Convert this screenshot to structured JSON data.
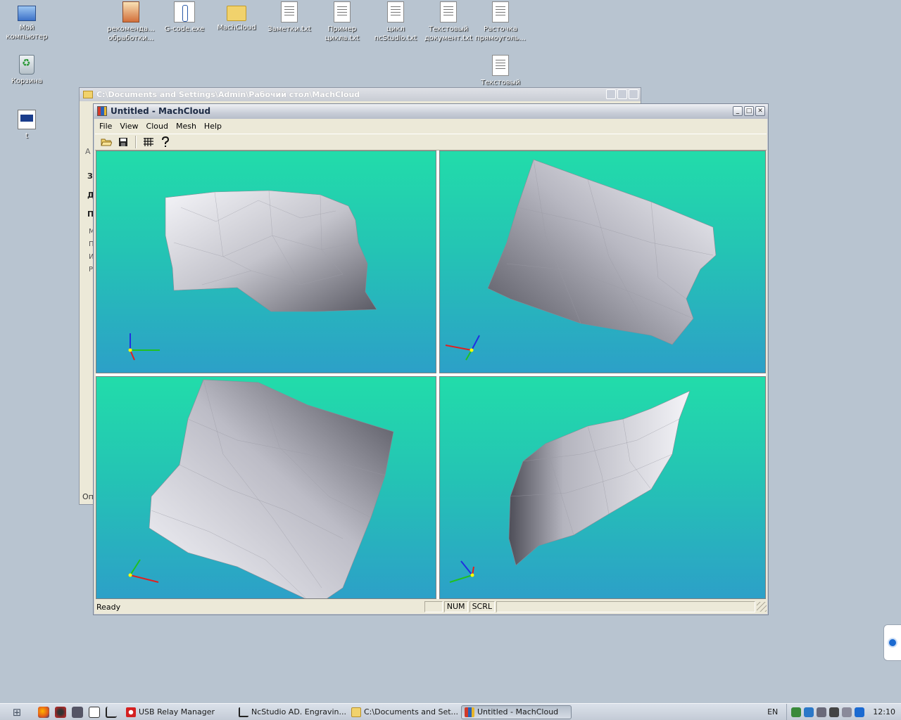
{
  "desktop": {
    "icons": [
      {
        "label": "Мой компьютер",
        "icon": "my-computer-icon"
      },
      {
        "label": "Корзина",
        "icon": "recycle-bin-icon"
      },
      {
        "label": "t",
        "icon": "application-shortcut-icon"
      },
      {
        "label": "рекоменда... обработки...",
        "icon": "winrar-archive-icon"
      },
      {
        "label": "G-code.exe",
        "icon": "gcode-exe-icon"
      },
      {
        "label": "MachCloud",
        "icon": "folder-icon"
      },
      {
        "label": "Заметки.txt",
        "icon": "text-document-icon"
      },
      {
        "label": "Пример цикла.txt",
        "icon": "text-document-icon"
      },
      {
        "label": "цикл ncStudio.txt",
        "icon": "text-document-icon"
      },
      {
        "label": "Текстовый документ.txt",
        "icon": "text-document-icon"
      },
      {
        "label": "Расточка прямоуголь...",
        "icon": "text-document-icon"
      },
      {
        "label": "Текстовый",
        "icon": "text-document-icon"
      }
    ]
  },
  "explorer": {
    "title": "C:\\Documents and Settings\\Admin\\Рабочий стол\\MachCloud",
    "side_fragments": [
      "З",
      "Д",
      "П"
    ],
    "side_small": [
      "М",
      "П",
      "И",
      "Р"
    ],
    "partial_address": "А",
    "partial_status": "Оп"
  },
  "app": {
    "title": "Untitled - MachCloud",
    "menu": [
      "File",
      "View",
      "Cloud",
      "Mesh",
      "Help"
    ],
    "toolbar": {
      "open": "open-folder-icon",
      "save": "save-disk-icon",
      "grid": "mesh-grid-icon",
      "help": "help-question-icon"
    },
    "viewports": [
      "top-left",
      "top-right",
      "bottom-left",
      "bottom-right"
    ],
    "status": {
      "ready": "Ready",
      "num": "NUM",
      "scrl": "SCRL"
    },
    "colors": {
      "viewport_top": "#22dcaa",
      "viewport_bottom": "#2ca0c8",
      "mesh_light": "#f2f2f6",
      "mesh_dark": "#55555f",
      "axis_x": "#e02020",
      "axis_y": "#20c020",
      "axis_z": "#2030e0",
      "axis_origin": "#ffff00"
    }
  },
  "taskbar": {
    "tasks": [
      {
        "label": "USB Relay Manager",
        "active": false
      },
      {
        "label": "NcStudio AD. Engravin...",
        "active": false
      },
      {
        "label": "C:\\Documents and Set...",
        "active": false
      },
      {
        "label": "Untitled - MachCloud",
        "active": true
      }
    ],
    "language": "EN",
    "clock": "12:10"
  }
}
